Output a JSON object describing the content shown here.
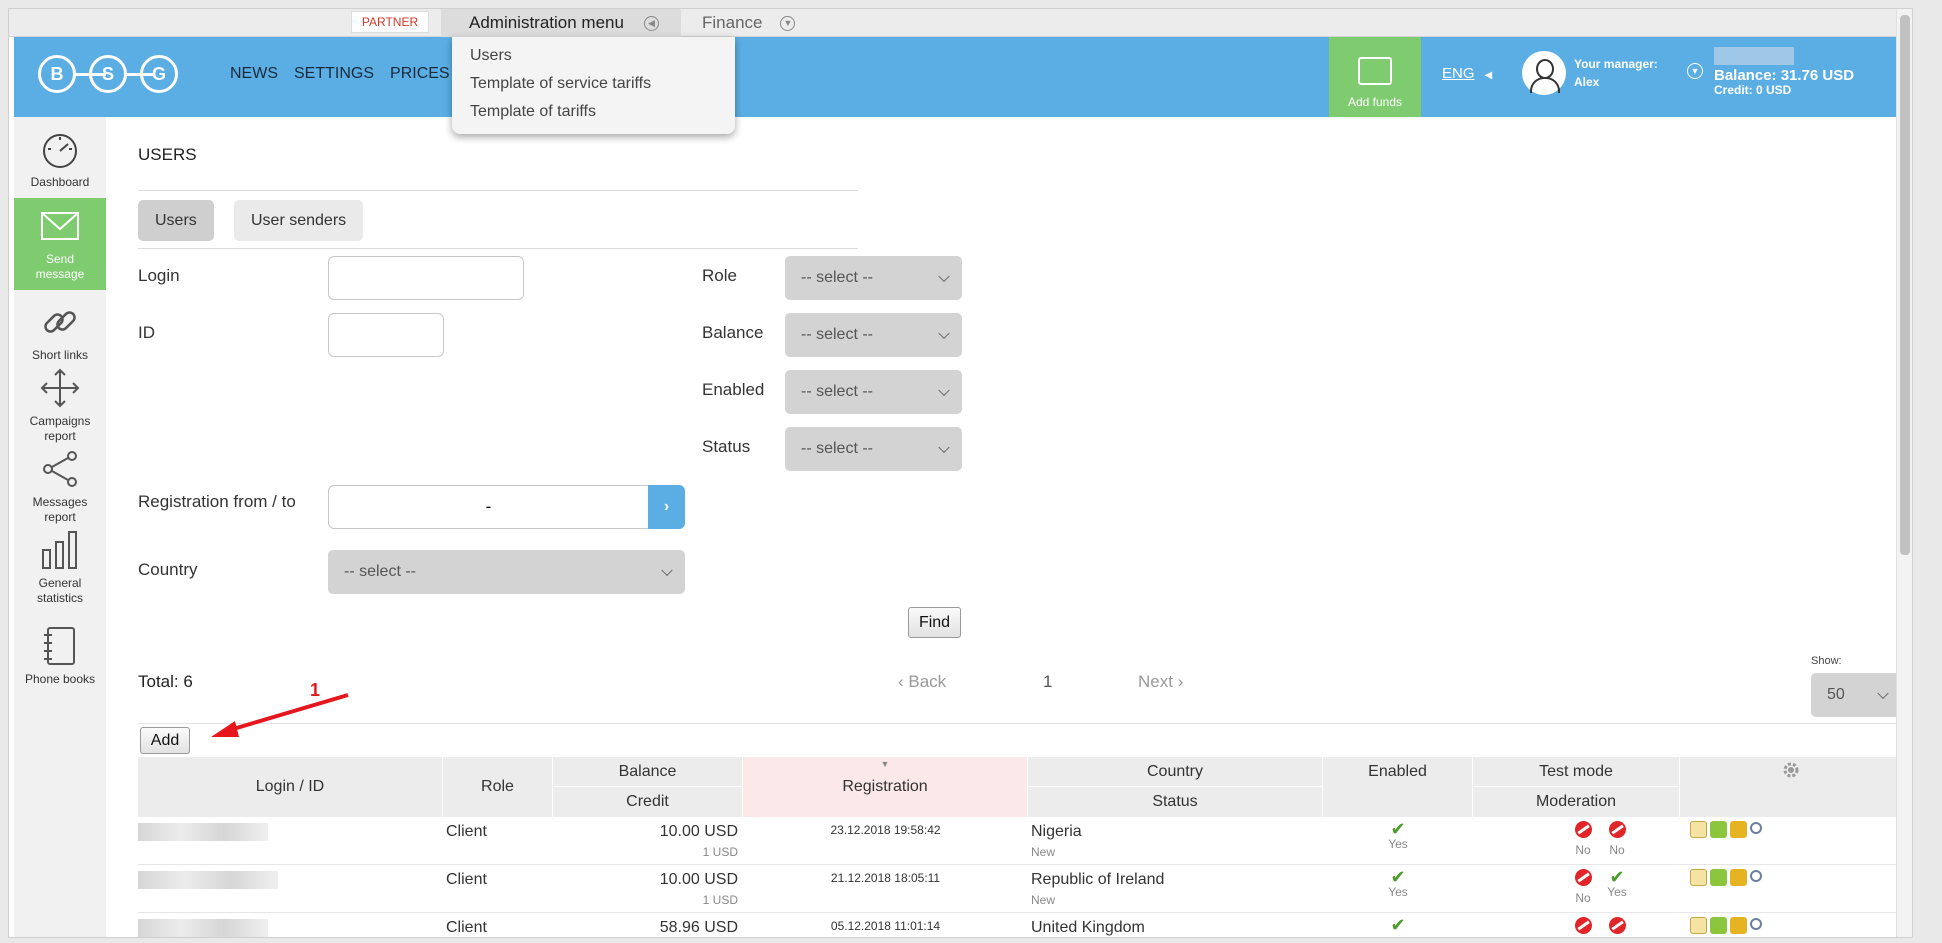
{
  "topbar": {
    "partner": "PARTNER",
    "admin_menu": "Administration menu",
    "finance": "Finance",
    "dropdown": [
      "Users",
      "Template of service tariffs",
      "Template of tariffs"
    ]
  },
  "header": {
    "logo_letters": [
      "B",
      "S",
      "G"
    ],
    "nav": [
      "NEWS",
      "SETTINGS",
      "PRICES"
    ],
    "add_funds": "Add funds",
    "language": "ENG",
    "manager_label": "Your manager:",
    "manager_name": "Alex",
    "balance": "Balance: 31.76 USD",
    "credit": "Credit: 0 USD"
  },
  "sidebar": {
    "items": [
      {
        "label": "Dashboard",
        "icon": "dashboard-icon"
      },
      {
        "label": "Send message",
        "icon": "envelope-icon"
      },
      {
        "label": "Short links",
        "icon": "link-icon"
      },
      {
        "label": "Campaigns report",
        "icon": "move-icon"
      },
      {
        "label": "Messages report",
        "icon": "share-icon"
      },
      {
        "label": "General statistics",
        "icon": "bar-chart-icon"
      },
      {
        "label": "Phone books",
        "icon": "notebook-icon"
      }
    ]
  },
  "page": {
    "title": "USERS",
    "tabs": [
      "Users",
      "User senders"
    ],
    "filters": {
      "login": "Login",
      "id": "ID",
      "role": "Role",
      "balance": "Balance",
      "enabled": "Enabled",
      "status": "Status",
      "registration": "Registration from / to",
      "country": "Country",
      "select_placeholder": "-- select --",
      "date_separator": "-"
    },
    "find": "Find",
    "total": "Total: 6",
    "back": "Back",
    "page_number": "1",
    "next": "Next",
    "show_label": "Show:",
    "show_value": "50",
    "add": "Add",
    "annotation": "1"
  },
  "table": {
    "headers": {
      "login": "Login / ID",
      "role": "Role",
      "balance": "Balance",
      "credit": "Credit",
      "registration": "Registration",
      "country": "Country",
      "status": "Status",
      "enabled": "Enabled",
      "test_mode": "Test mode",
      "moderation": "Moderation"
    },
    "rows": [
      {
        "role": "Client",
        "balance": "10.00 USD",
        "credit": "1 USD",
        "registration": "23.12.2018 19:58:42",
        "country": "Nigeria",
        "status": "New",
        "enabled": "Yes",
        "test_mode": "No",
        "moderation": "No",
        "moderation_ok": false
      },
      {
        "role": "Client",
        "balance": "10.00 USD",
        "credit": "1 USD",
        "registration": "21.12.2018 18:05:11",
        "country": "Republic of Ireland",
        "status": "New",
        "enabled": "Yes",
        "test_mode": "No",
        "moderation": "Yes",
        "moderation_ok": true
      },
      {
        "role": "Client",
        "balance": "58.96 USD",
        "credit": "",
        "registration": "05.12.2018 11:01:14",
        "country": "United Kingdom",
        "status": "",
        "enabled": "",
        "test_mode": "",
        "moderation": "",
        "moderation_ok": false
      }
    ]
  },
  "colors": {
    "header_blue": "#5baee4",
    "green": "#7fcb6f",
    "red": "#e0262a"
  }
}
